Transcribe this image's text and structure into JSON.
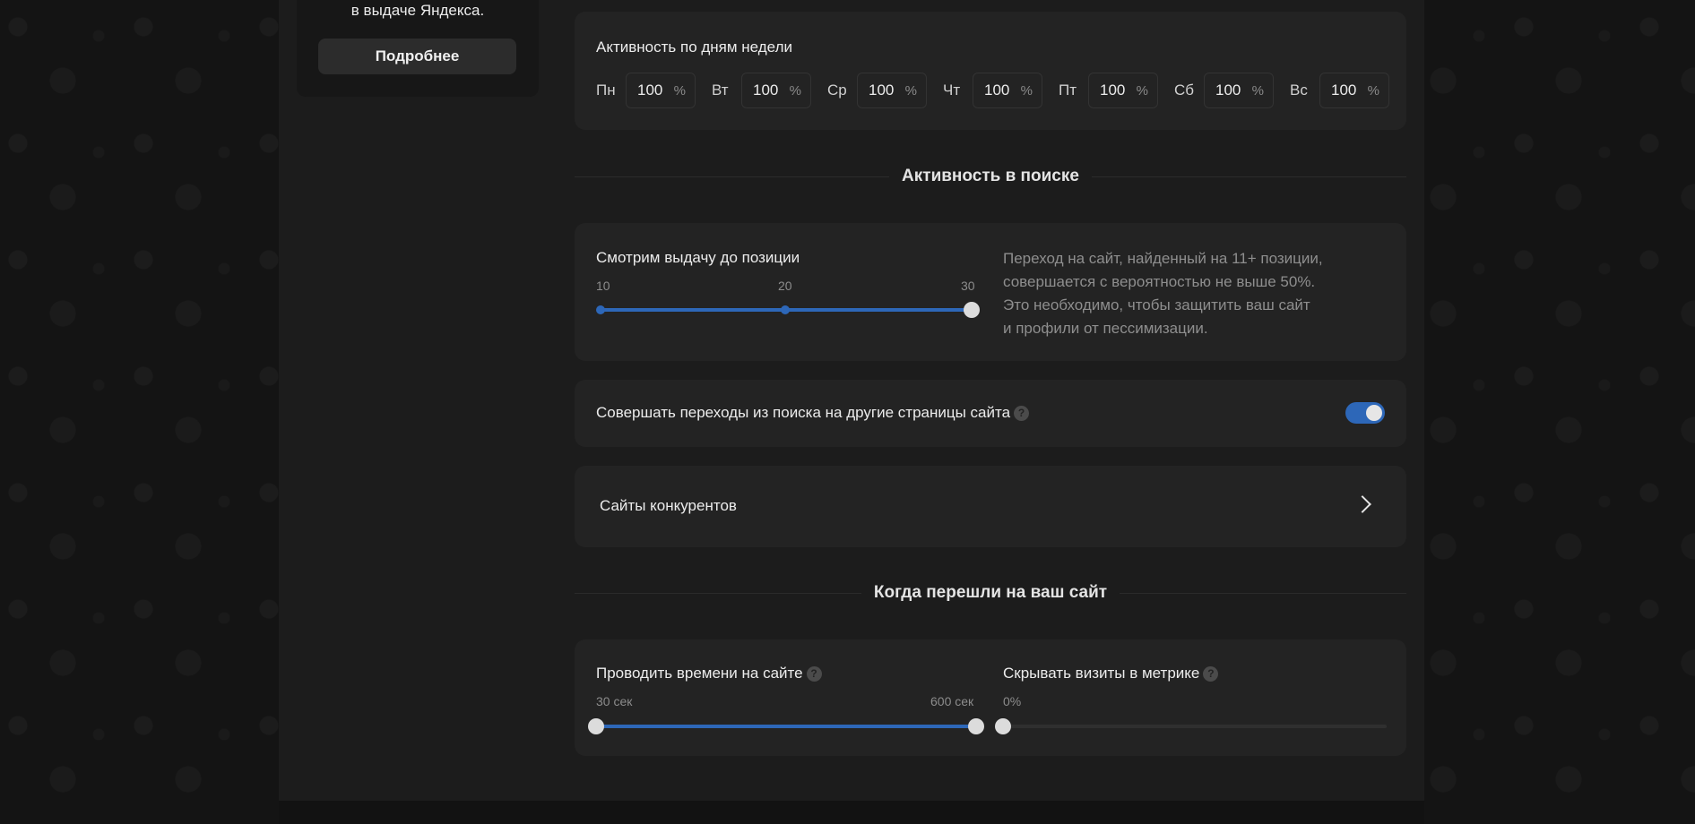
{
  "left_card": {
    "text": "в выдаче Яндекса.",
    "button_label": "Подробнее"
  },
  "weekdays": {
    "title": "Активность по дням недели",
    "unit": "%",
    "days": [
      {
        "label": "Пн",
        "value": "100"
      },
      {
        "label": "Вт",
        "value": "100"
      },
      {
        "label": "Ср",
        "value": "100"
      },
      {
        "label": "Чт",
        "value": "100"
      },
      {
        "label": "Пт",
        "value": "100"
      },
      {
        "label": "Сб",
        "value": "100"
      },
      {
        "label": "Вс",
        "value": "100"
      }
    ]
  },
  "search_section": {
    "heading": "Активность в поиске"
  },
  "position_slider": {
    "label": "Смотрим выдачу до позиции",
    "ticks": [
      "10",
      "20",
      "30"
    ],
    "value": 30,
    "min": 10,
    "max": 30,
    "description_lines": [
      "Переход на сайт, найденный на 11+ позиции,",
      "совершается с вероятностью не выше 50%.",
      "Это необходимо, чтобы защитить ваш сайт",
      "и профили от пессимизации."
    ]
  },
  "inner_transitions": {
    "label": "Совершать переходы из поиска на другие страницы сайта",
    "help": "?",
    "enabled": true
  },
  "competitors": {
    "label": "Сайты конкурентов"
  },
  "visit_section": {
    "heading": "Когда перешли на ваш сайт"
  },
  "time_on_site": {
    "label": "Проводить времени на сайте",
    "help": "?",
    "min_label": "30 сек",
    "max_label": "600 сек",
    "range": [
      30,
      600
    ]
  },
  "hide_visits": {
    "label": "Скрывать визиты в метрике",
    "help": "?",
    "value_label": "0%",
    "value": 0
  },
  "colors": {
    "accent": "#2d67b8",
    "background": "#1c1c1c",
    "card": "#232323"
  }
}
